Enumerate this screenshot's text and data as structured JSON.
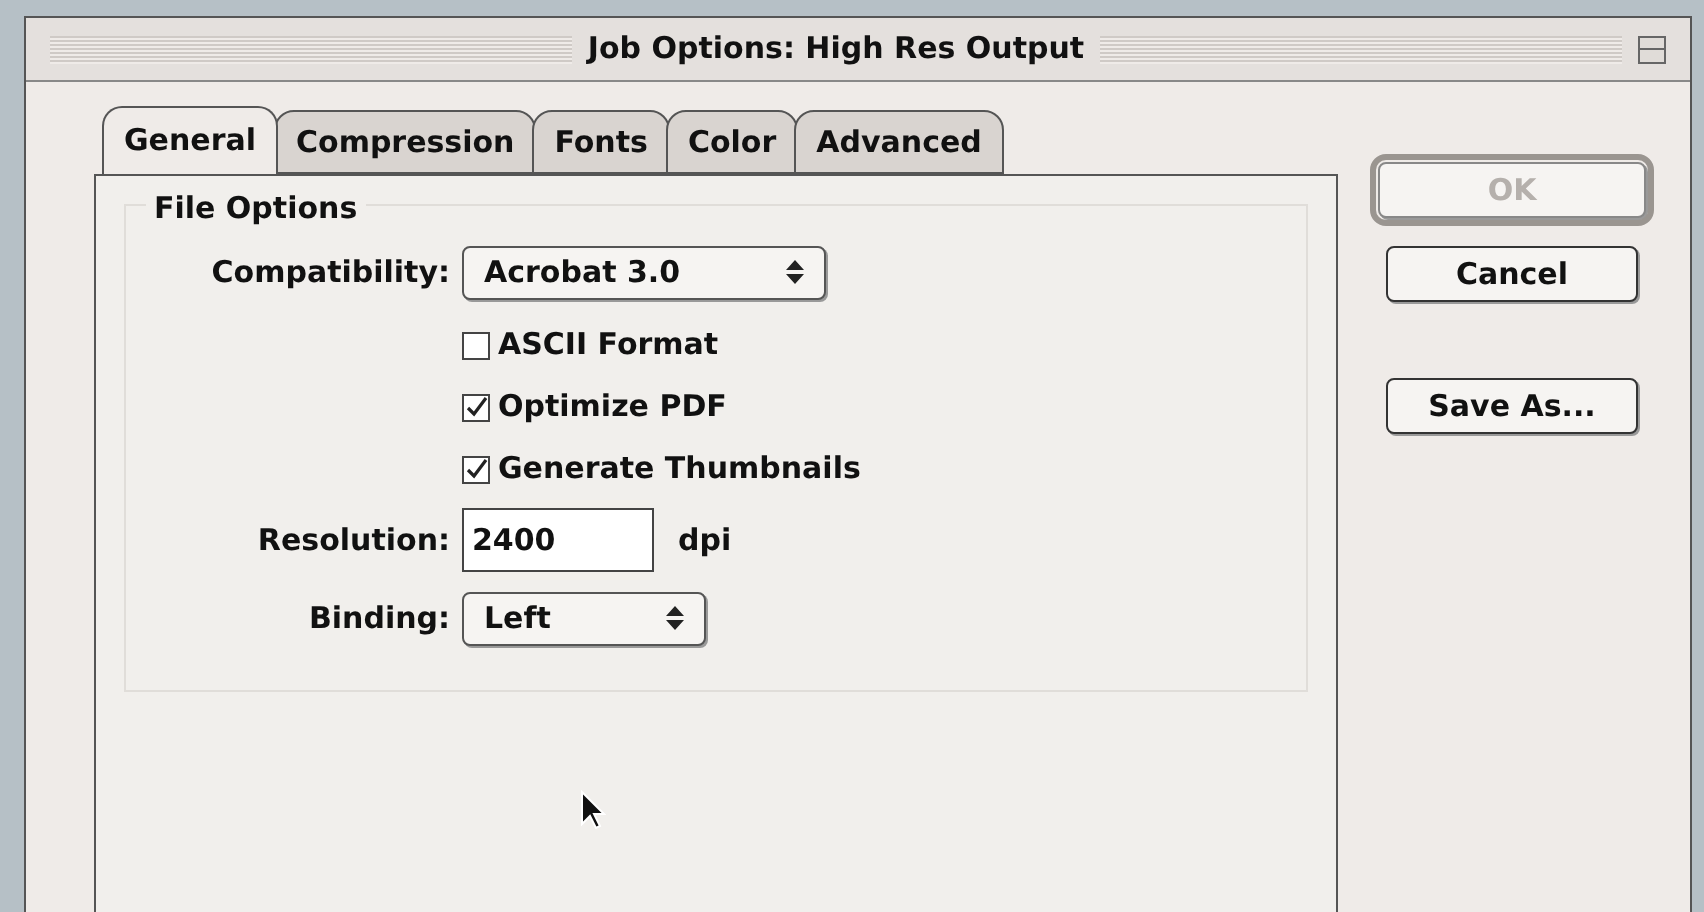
{
  "window": {
    "title": "Job Options: High Res Output"
  },
  "tabs": [
    {
      "label": "General",
      "selected": true
    },
    {
      "label": "Compression",
      "selected": false
    },
    {
      "label": "Fonts",
      "selected": false
    },
    {
      "label": "Color",
      "selected": false
    },
    {
      "label": "Advanced",
      "selected": false
    }
  ],
  "group": {
    "title": "File Options"
  },
  "compatibility": {
    "label": "Compatibility:",
    "value": "Acrobat 3.0"
  },
  "checkboxes": [
    {
      "label": "ASCII Format",
      "checked": false
    },
    {
      "label": "Optimize PDF",
      "checked": true
    },
    {
      "label": "Generate Thumbnails",
      "checked": true
    }
  ],
  "resolution": {
    "label": "Resolution:",
    "value": "2400",
    "unit": "dpi"
  },
  "binding": {
    "label": "Binding:",
    "value": "Left"
  },
  "buttons": [
    {
      "label": "OK",
      "disabled": true,
      "default": true
    },
    {
      "label": "Cancel",
      "disabled": false,
      "default": false
    },
    {
      "label": "Save As...",
      "disabled": false,
      "default": false
    }
  ]
}
